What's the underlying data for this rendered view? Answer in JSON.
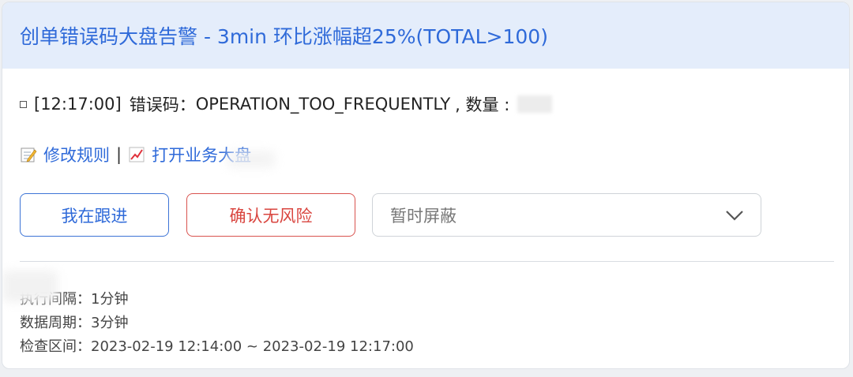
{
  "header": {
    "title": "创单错误码大盘告警  - 3min 环比涨幅超25%(TOTAL>100)"
  },
  "alert": {
    "time": "[12:17:00]",
    "code_label": "错误码：",
    "code_value": "OPERATION_TOO_FREQUENTLY",
    "count_label": ", 数量 :"
  },
  "links": {
    "edit_rule": "修改规则",
    "separator": "|",
    "open_dashboard": "打开业务大盘"
  },
  "actions": {
    "follow_label": "我在跟进",
    "no_risk_label": "确认无风险",
    "mute_select_value": "暂时屏蔽"
  },
  "meta": {
    "interval": "执行间隔：1分钟",
    "period": "数据周期：3分钟",
    "range": "检查区间：2023-02-19 12:14:00 ~ 2023-02-19 12:17:00"
  },
  "colors": {
    "accent": "#2f6ad9",
    "danger": "#d9453f",
    "header_bg": "#e4edfb"
  }
}
